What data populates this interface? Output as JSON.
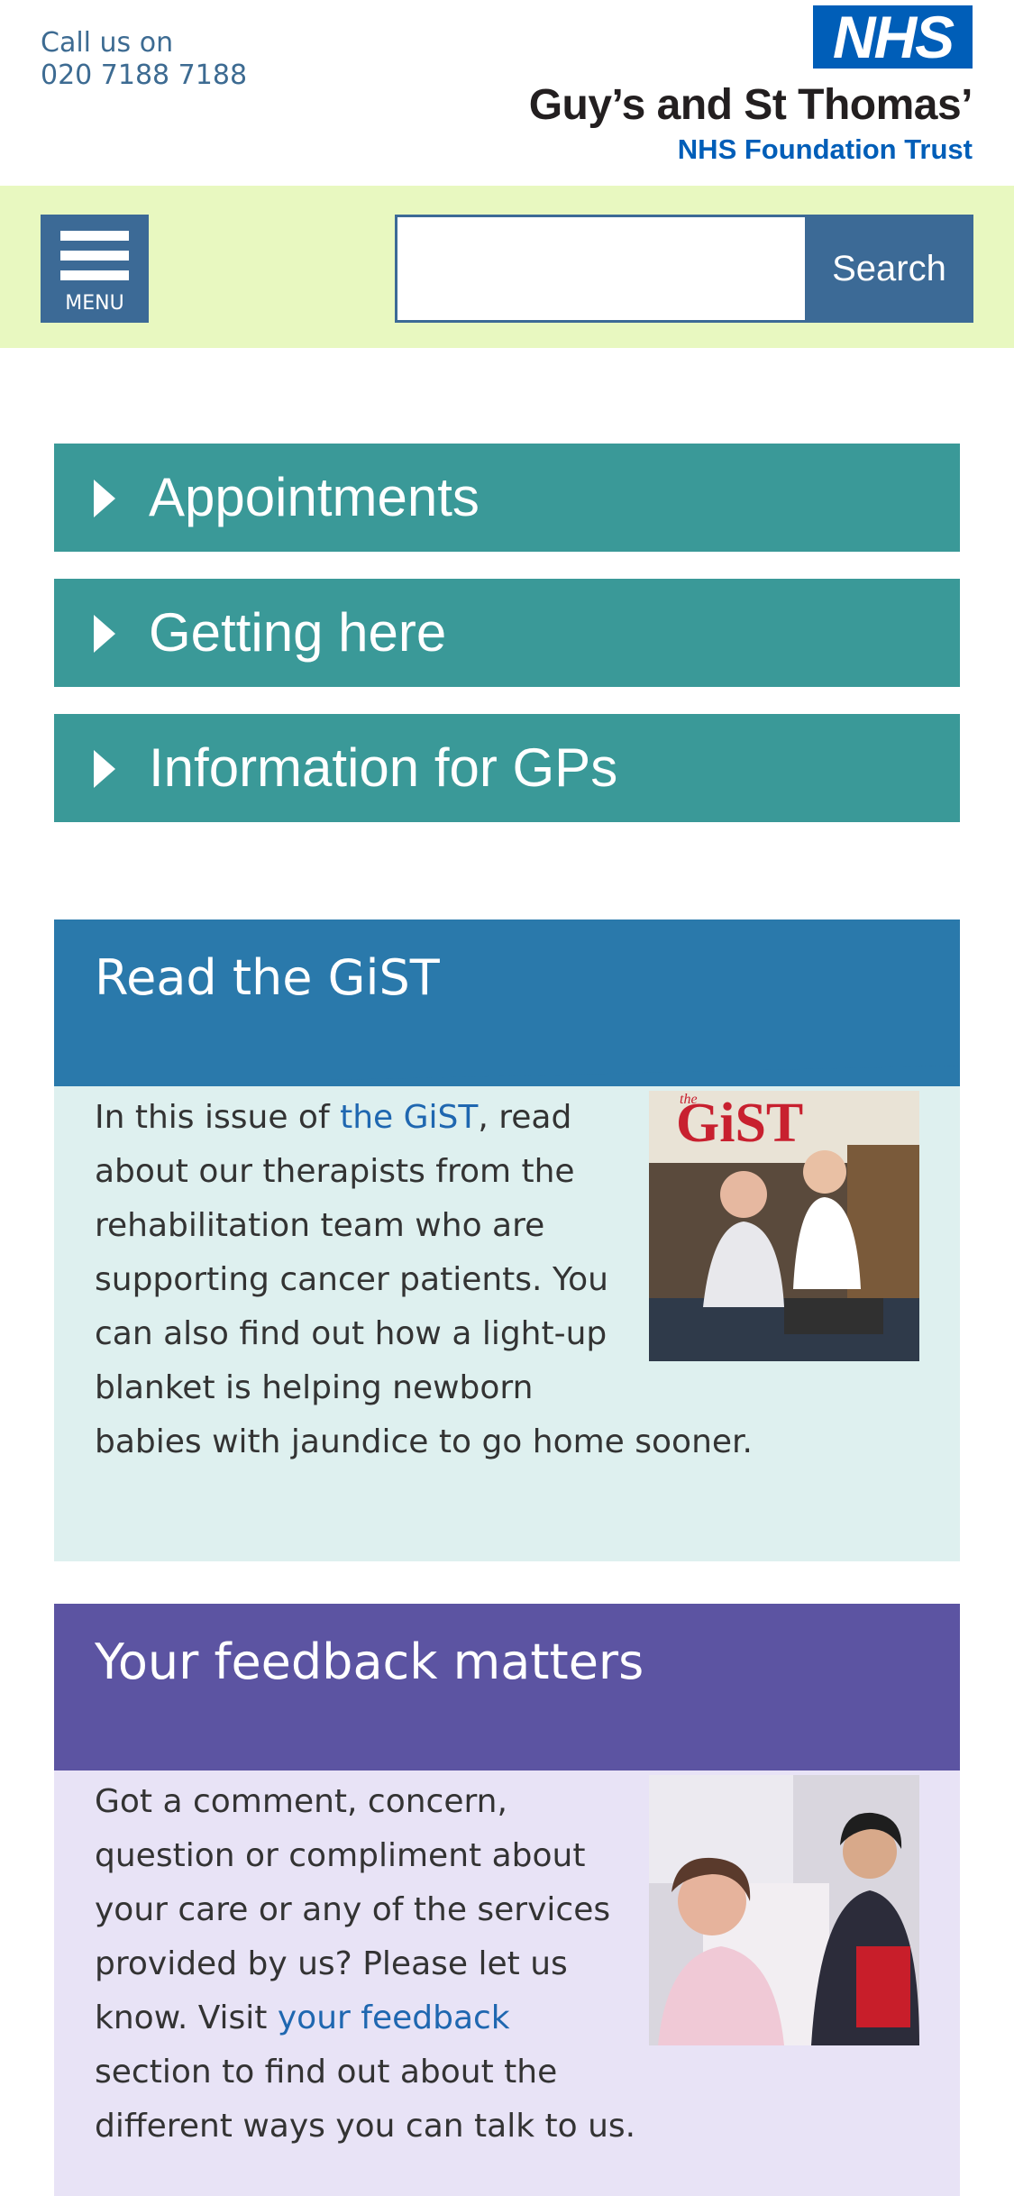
{
  "header": {
    "call_line1": "Call us on",
    "call_line2": "020 7188 7188",
    "logo_nhs": "NHS",
    "logo_trust": "Guy’s and St Thomas’",
    "logo_subtitle": "NHS Foundation Trust"
  },
  "nav": {
    "menu_label": "MENU",
    "search_value": "",
    "search_button": "Search"
  },
  "accordion": [
    {
      "label": "Appointments"
    },
    {
      "label": "Getting here"
    },
    {
      "label": "Information for GPs"
    }
  ],
  "gist": {
    "title": "Read the GiST",
    "text_before_link": "In this issue of ",
    "link_text": "the GiST",
    "text_after_link": ", read about our therapists from the rehabilitation team who are supporting cancer patients. You can also find out how a light-up blanket is helping newborn babies with jaundice to go home sooner.",
    "cover_masthead": "GiST",
    "cover_the": "the"
  },
  "feedback": {
    "title": "Your feedback matters",
    "text_before_link": "Got a comment, concern, question or compliment about your care or any of the services provided by us? Please let us know. Visit ",
    "link_text": "your feedback",
    "text_after_link": " section to find out about the different ways you can talk to us."
  },
  "colors": {
    "nav_background": "#e8f8c0",
    "accordion": "#3a9998",
    "gist_header": "#2a79ab",
    "gist_body": "#def0ef",
    "feedback_header": "#5c54a2",
    "feedback_body": "#e8e3f6",
    "link": "#1f67b0",
    "nhs_blue": "#005eb8"
  },
  "icons": {
    "menu": "hamburger-icon",
    "accordion": "caret-right-icon"
  }
}
